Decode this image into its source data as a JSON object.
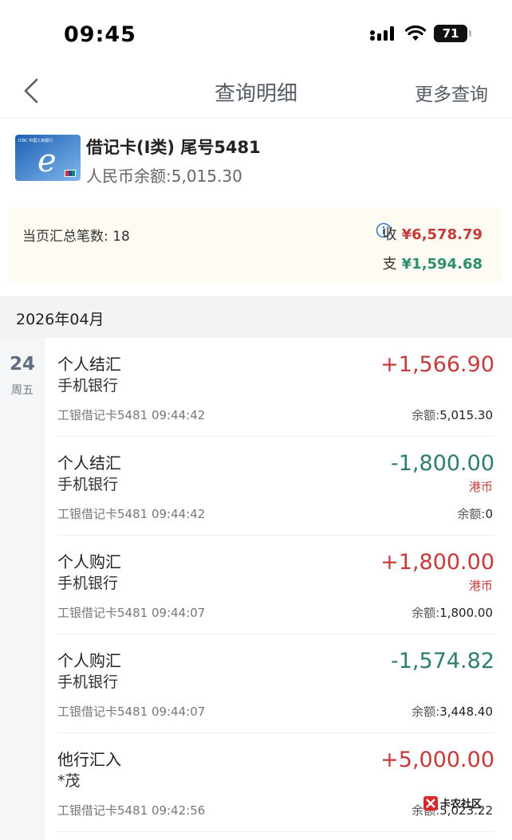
{
  "status_bar": {
    "time": "09:45",
    "battery": "71"
  },
  "nav": {
    "title": "查询明细",
    "more": "更多查询"
  },
  "card": {
    "name": "借记卡(I类) 尾号5481",
    "balance": "人民币余额:5,015.30",
    "image_label": "ICBC 中国工商银行"
  },
  "summary": {
    "count_label": "当页汇总笔数: 18",
    "in_label": "收",
    "in_value": "¥6,578.79",
    "out_label": "支",
    "out_value": "¥1,594.68"
  },
  "month": "2026年04月",
  "date": {
    "day": "24",
    "weekday": "周五"
  },
  "transactions": [
    {
      "title": "个人结汇",
      "channel": "手机银行",
      "account": "工银借记卡5481",
      "time": "09:44:42",
      "amount": "+1,566.90",
      "currency": "",
      "balance_label": "余额:",
      "balance": "5,015.30",
      "sign": "pos"
    },
    {
      "title": "个人结汇",
      "channel": "手机银行",
      "account": "工银借记卡5481",
      "time": "09:44:42",
      "amount": "-1,800.00",
      "currency": "港币",
      "balance_label": "余额:",
      "balance": "0",
      "sign": "neg"
    },
    {
      "title": "个人购汇",
      "channel": "手机银行",
      "account": "工银借记卡5481",
      "time": "09:44:07",
      "amount": "+1,800.00",
      "currency": "港币",
      "balance_label": "余额:",
      "balance": "1,800.00",
      "sign": "pos"
    },
    {
      "title": "个人购汇",
      "channel": "手机银行",
      "account": "工银借记卡5481",
      "time": "09:44:07",
      "amount": "-1,574.82",
      "currency": "",
      "balance_label": "余额:",
      "balance": "3,448.40",
      "sign": "neg"
    },
    {
      "title": "他行汇入",
      "channel": "*茂",
      "account": "工银借记卡5481",
      "time": "09:42:56",
      "amount": "+5,000.00",
      "currency": "",
      "balance_label": "余额:",
      "balance": "5,023.22",
      "sign": "pos"
    }
  ],
  "watermark": "卡农社区",
  "colors": {
    "income": "#c53a3a",
    "expense": "#2e7d70",
    "summary_bg": "#fdfbf2"
  }
}
